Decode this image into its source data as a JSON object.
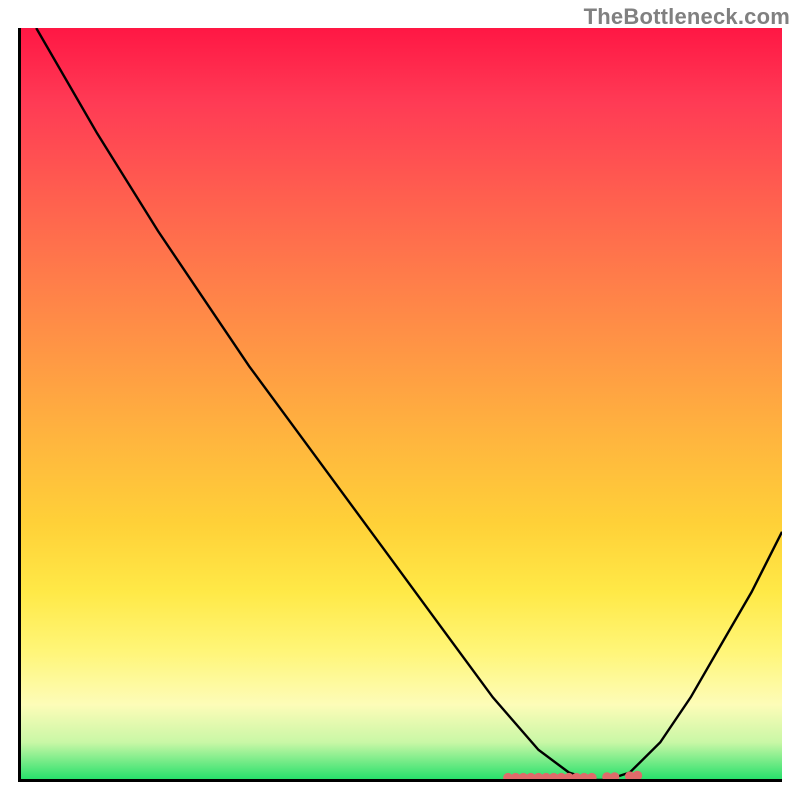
{
  "watermark": "TheBottleneck.com",
  "chart_data": {
    "type": "line",
    "title": "",
    "xlabel": "",
    "ylabel": "",
    "xlim": [
      0,
      100
    ],
    "ylim": [
      0,
      100
    ],
    "series": [
      {
        "name": "curve",
        "x": [
          2,
          10,
          18,
          24,
          30,
          38,
          46,
          54,
          62,
          68,
          72,
          75,
          77,
          80,
          84,
          88,
          92,
          96,
          100
        ],
        "y": [
          100,
          86,
          73,
          64,
          55,
          44,
          33,
          22,
          11,
          4,
          1,
          0,
          0,
          1,
          5,
          11,
          18,
          25,
          33
        ]
      }
    ],
    "scatter_points": {
      "name": "baseline-dots",
      "color": "#e06a6a",
      "x": [
        64,
        65,
        66,
        67,
        68,
        69,
        70,
        71,
        72,
        73,
        74,
        75,
        77,
        78,
        80,
        81
      ],
      "y": [
        0.3,
        0.3,
        0.3,
        0.3,
        0.3,
        0.3,
        0.3,
        0.3,
        0.3,
        0.3,
        0.3,
        0.3,
        0.4,
        0.4,
        0.5,
        0.6
      ]
    },
    "gradient": {
      "top_color": "#ff1744",
      "bottom_color": "#24e06a",
      "stops": [
        "red",
        "orange",
        "yellow",
        "green"
      ]
    }
  }
}
